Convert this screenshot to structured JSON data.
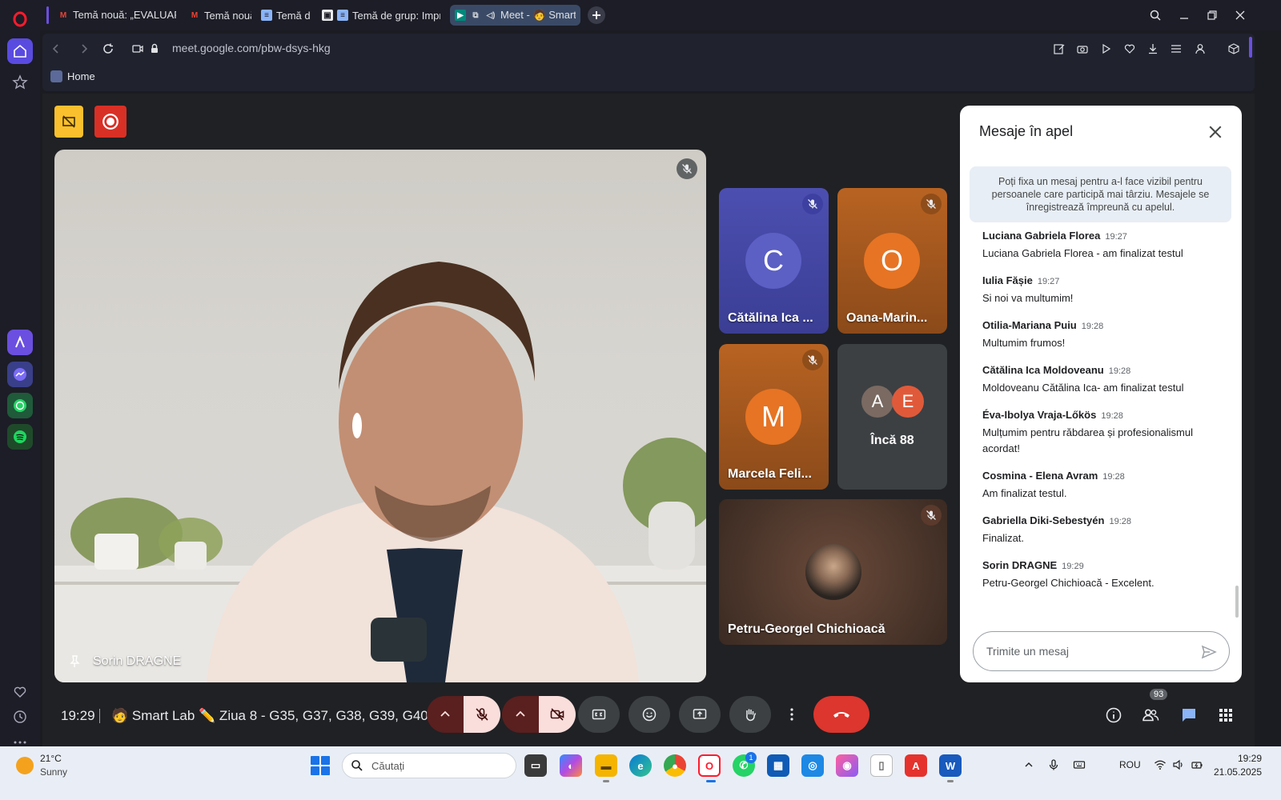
{
  "browser": {
    "tabs": [
      {
        "label": "Temă nouă: „EVALUARE 💡",
        "favicon": "gmail-icon"
      },
      {
        "label": "Temă nouă: „",
        "favicon": "gmail-icon"
      },
      {
        "label": "Temă de c",
        "favicon": "document-icon"
      },
      {
        "label": "Temă de grup: Imprim",
        "favicon": "classroom-icon"
      },
      {
        "label": "Meet - 🧑 Smart L",
        "favicon": "meet-icon",
        "active": true
      }
    ],
    "url": "meet.google.com/pbw-dsys-hkg",
    "bookmarks": [
      {
        "label": "Home"
      }
    ]
  },
  "meet": {
    "main_tile": {
      "name": "Sorin DRAGNE",
      "muted": true
    },
    "tiles": [
      {
        "name": "Cătălina Ica ...",
        "initial": "C",
        "color": "#5c5fc4",
        "muted": true
      },
      {
        "name": "Oana-Marin...",
        "initial": "O",
        "color": "#e67424",
        "muted": true
      },
      {
        "name": "Marcela Feli...",
        "initial": "M",
        "color": "#e67424",
        "muted": true
      },
      {
        "name": "Petru-Georgel Chichioacă",
        "muted": true
      }
    ],
    "others": {
      "label": "Încă 88",
      "initials": [
        "A",
        "E"
      ]
    },
    "clock": "19:29",
    "meeting_title": "🧑 Smart Lab ✏️ Ziua 8 - G35, G37, G38, G39, G40",
    "people_count": "93"
  },
  "chat": {
    "title": "Mesaje în apel",
    "info": "Poți fixa un mesaj pentru a-l face vizibil pentru persoanele care participă mai târziu. Mesajele se înregistrează împreună cu apelul.",
    "messages": [
      {
        "sender": "Luciana Gabriela Florea",
        "time": "19:27",
        "text": "Luciana Gabriela Florea - am finalizat testul"
      },
      {
        "sender": "Iulia Fășie",
        "time": "19:27",
        "text": "Si noi va multumim!"
      },
      {
        "sender": "Otilia-Mariana Puiu",
        "time": "19:28",
        "text": "Multumim frumos!"
      },
      {
        "sender": "Cătălina Ica Moldoveanu",
        "time": "19:28",
        "text": "Moldoveanu Cătălina Ica- am finalizat testul"
      },
      {
        "sender": "Éva-Ibolya Vraja-Lőkös",
        "time": "19:28",
        "text": "Mulțumim pentru răbdarea și profesionalismul acordat!"
      },
      {
        "sender": "Cosmina - Elena Avram",
        "time": "19:28",
        "text": "Am finalizat testul."
      },
      {
        "sender": "Gabriella Diki-Sebestyén",
        "time": "19:28",
        "text": "Finalizat."
      },
      {
        "sender": "Sorin DRAGNE",
        "time": "19:29",
        "text": "Petru-Georgel Chichioacă - Excelent."
      }
    ],
    "input_placeholder": "Trimite un mesaj"
  },
  "taskbar": {
    "weather_temp": "21°C",
    "weather_desc": "Sunny",
    "search_placeholder": "Căutați",
    "language": "ROU",
    "time": "19:29",
    "date": "21.05.2025",
    "whatsapp_badge": "1"
  },
  "colors": {
    "end_call": "#dc362e",
    "muted_control_bg": "#f9dedc",
    "accent": "#1a73e8"
  }
}
